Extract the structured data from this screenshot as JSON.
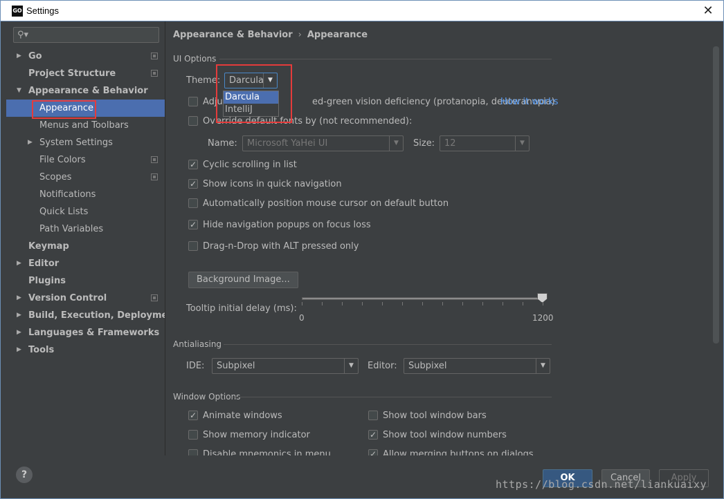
{
  "window": {
    "title": "Settings",
    "app_icon": "GO"
  },
  "sidebar": {
    "search_placeholder": "",
    "items": [
      {
        "label": "Go",
        "bold": true,
        "arrow": "right"
      },
      {
        "label": "Project Structure",
        "bold": true
      },
      {
        "label": "Appearance & Behavior",
        "bold": true,
        "arrow": "down"
      },
      {
        "label": "Appearance",
        "selected": true
      },
      {
        "label": "Menus and Toolbars"
      },
      {
        "label": "System Settings",
        "arrow": "right"
      },
      {
        "label": "File Colors"
      },
      {
        "label": "Scopes"
      },
      {
        "label": "Notifications"
      },
      {
        "label": "Quick Lists"
      },
      {
        "label": "Path Variables"
      },
      {
        "label": "Keymap",
        "bold": true
      },
      {
        "label": "Editor",
        "bold": true,
        "arrow": "right"
      },
      {
        "label": "Plugins",
        "bold": true
      },
      {
        "label": "Version Control",
        "bold": true,
        "arrow": "right"
      },
      {
        "label": "Build, Execution, Deployment",
        "bold": true,
        "arrow": "right"
      },
      {
        "label": "Languages & Frameworks",
        "bold": true,
        "arrow": "right"
      },
      {
        "label": "Tools",
        "bold": true,
        "arrow": "right"
      }
    ],
    "help": "?"
  },
  "breadcrumb": {
    "parent": "Appearance & Behavior",
    "separator": "›",
    "current": "Appearance"
  },
  "ui_options": {
    "section": "UI Options",
    "theme_label": "Theme:",
    "theme_value": "Darcula",
    "theme_options": [
      "Darcula",
      "IntelliJ"
    ],
    "adjust_prefix": "Adjus",
    "adjust_suffix": "ed-green vision deficiency (protanopia, deuteranopia)",
    "how_it_works": "How it works",
    "override_prefix": "Ov",
    "override_text": "erride default fonts by (not recommended):",
    "name_label": "Name:",
    "font_name": "Microsoft YaHei UI",
    "size_label": "Size:",
    "font_size": "12",
    "cyclic": "Cyclic scrolling in list",
    "show_icons": "Show icons in quick navigation",
    "auto_position": "Automatically position mouse cursor on default button",
    "hide_popups": "Hide navigation popups on focus loss",
    "drag_drop": "Drag-n-Drop with ALT pressed only",
    "background_button": "Background Image...",
    "tooltip_label": "Tooltip initial delay (ms):",
    "slider_min": "0",
    "slider_max": "1200",
    "slider_value": 1200
  },
  "antialiasing": {
    "section": "Antialiasing",
    "ide_label": "IDE:",
    "ide_value": "Subpixel",
    "editor_label": "Editor:",
    "editor_value": "Subpixel"
  },
  "window_options": {
    "section": "Window Options",
    "animate": "Animate windows",
    "memory": "Show memory indicator",
    "mnemonics": "Disable mnemonics in menu",
    "tool_bars": "Show tool window bars",
    "tool_numbers": "Show tool window numbers",
    "merging": "Allow merging buttons on dialogs"
  },
  "buttons": {
    "ok": "OK",
    "cancel": "Cancel",
    "apply": "Apply"
  },
  "watermark": "https://blog.csdn.net/liankuaixy",
  "colors": {
    "selection": "#4b6eaf",
    "highlight_box": "#e53b3b",
    "link": "#589df6"
  }
}
